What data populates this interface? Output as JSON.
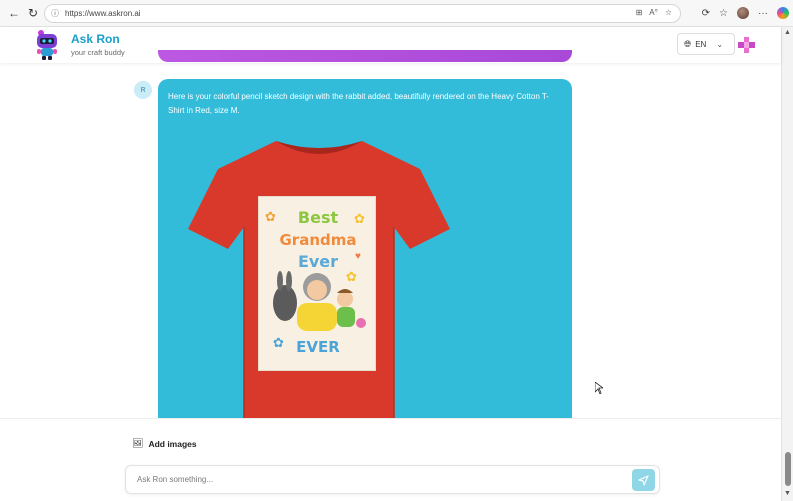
{
  "browser": {
    "url": "https://www.askron.ai",
    "icons": [
      "back-icon",
      "refresh-icon",
      "site-info-icon",
      "reader-view-icon",
      "read-aloud-icon",
      "favorite-icon",
      "extensions-icon",
      "favorites-bar-icon",
      "profile-icon",
      "more-icon",
      "copilot-icon"
    ],
    "addr_right": {
      "reader": "⊞",
      "read_aloud": "A°",
      "favorite": "☆"
    }
  },
  "header": {
    "brand_name": "Ask Ron",
    "brand_tagline": "your craft buddy",
    "language": "EN",
    "accent_color": "#1aa0c8"
  },
  "chat": {
    "bot_avatar_initial": "R",
    "message_text": "Here is your colorful pencil sketch design with the rabbit added, beautifully rendered on the Heavy Cotton T-Shirt in Red, size M.",
    "bubble_color": "#32bcda",
    "shirt_color": "#d8392b",
    "design": {
      "line1": "Best",
      "line2": "Grandma",
      "line3": "Ever",
      "line4": "EVER"
    }
  },
  "composer": {
    "add_images_label": "Add images",
    "placeholder": "Ask Ron something...",
    "send_icon": "send-icon"
  }
}
